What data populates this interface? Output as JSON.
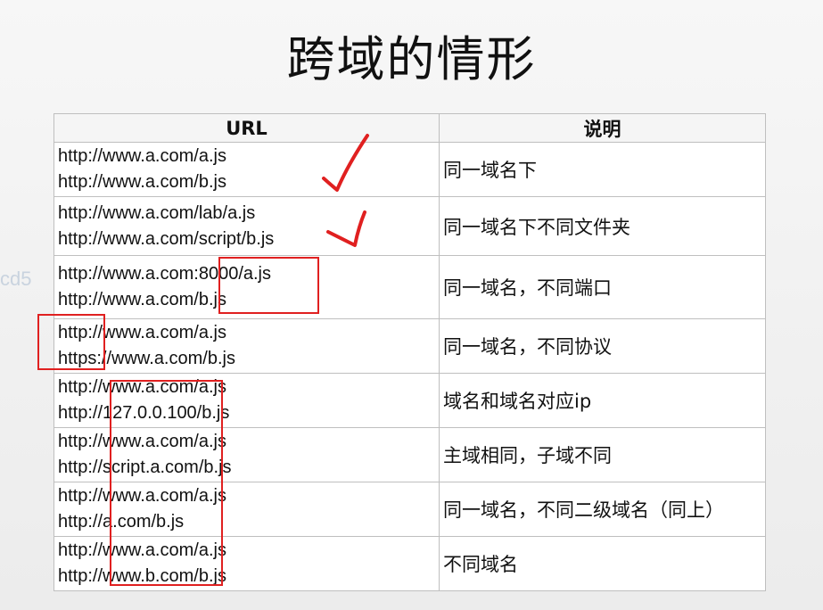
{
  "title": "跨域的情形",
  "side_text": "cd5",
  "table": {
    "headers": {
      "url": "URL",
      "description": "说明"
    },
    "rows": [
      {
        "url1": "http://www.a.com/a.js",
        "url2": "http://www.a.com/b.js",
        "desc": "同一域名下"
      },
      {
        "url1": "http://www.a.com/lab/a.js",
        "url2": "http://www.a.com/script/b.js",
        "desc": "同一域名下不同文件夹"
      },
      {
        "url1": "http://www.a.com:8000/a.js",
        "url2": "http://www.a.com/b.js",
        "desc": "同一域名，不同端口"
      },
      {
        "url1": "http://www.a.com/a.js",
        "url2": "https://www.a.com/b.js",
        "desc": "同一域名，不同协议"
      },
      {
        "url1": "http://www.a.com/a.js",
        "url2": "http://127.0.0.100/b.js",
        "desc": "域名和域名对应ip"
      },
      {
        "url1": "http://www.a.com/a.js",
        "url2": "http://script.a.com/b.js",
        "desc": "主域相同，子域不同"
      },
      {
        "url1": "http://www.a.com/a.js",
        "url2": "http://a.com/b.js",
        "desc": "同一域名，不同二级域名（同上）"
      },
      {
        "url1": "http://www.a.com/a.js",
        "url2": "http://www.b.com/b.js",
        "desc": "不同域名"
      }
    ]
  },
  "colors": {
    "annotation": "#e02020",
    "text": "#111111",
    "border": "#bfbfbf"
  }
}
